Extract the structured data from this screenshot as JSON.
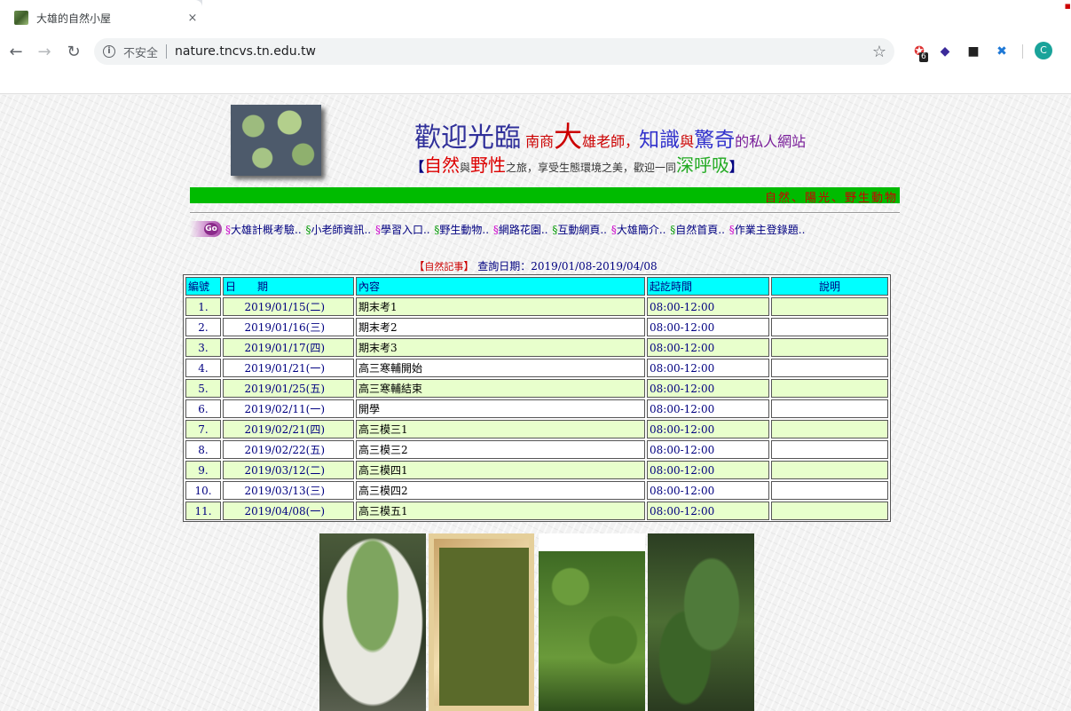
{
  "browser": {
    "tab_title": "大雄的自然小屋",
    "tab_close": "×",
    "insecure_label": "不安全",
    "url": "nature.tncvs.tn.edu.tw",
    "extension_badge": "6",
    "profile_initial": "C"
  },
  "header": {
    "welcome": {
      "part1": "歡迎光臨",
      "part2": "南商",
      "part3": "大",
      "part4": "雄老師，",
      "part5": "知識",
      "part6": "與",
      "part7": "驚奇",
      "part8": "的私人網站"
    },
    "slogan": {
      "open": "【",
      "a": "自然",
      "b": "與",
      "c": "野性",
      "d": "之旅，享受生態環境之美，歡迎一同",
      "e": "深呼吸",
      "close": "】"
    },
    "marquee": "自然、陽光、野生動物"
  },
  "nav": {
    "go_label": "Go",
    "links": [
      {
        "sec": "§",
        "label": "大雄計概考驗.."
      },
      {
        "sec": "§",
        "label": "小老師資訊.."
      },
      {
        "sec": "§",
        "label": "學習入口.."
      },
      {
        "sec": "§",
        "label": "野生動物.."
      },
      {
        "sec": "§",
        "label": "網路花園.."
      },
      {
        "sec": "§",
        "label": "互動網頁.."
      },
      {
        "sec": "§",
        "label": "大雄簡介.."
      },
      {
        "sec": "§",
        "label": "自然首頁.."
      },
      {
        "sec": "§",
        "label": "作業主登錄題.."
      }
    ]
  },
  "query": {
    "open": "【",
    "tag": "自然記事",
    "close": "】",
    "label": " 查詢日期：",
    "range": "2019/01/08-2019/04/08"
  },
  "table": {
    "headers": {
      "no": "編號",
      "date": "日　　期",
      "content": "內容",
      "time": "起訖時間",
      "note": "說明"
    },
    "rows": [
      {
        "no": "1.",
        "date": "2019/01/15(二)",
        "content": "期末考1",
        "time": "08:00-12:00",
        "note": ""
      },
      {
        "no": "2.",
        "date": "2019/01/16(三)",
        "content": "期末考2",
        "time": "08:00-12:00",
        "note": ""
      },
      {
        "no": "3.",
        "date": "2019/01/17(四)",
        "content": "期末考3",
        "time": "08:00-12:00",
        "note": ""
      },
      {
        "no": "4.",
        "date": "2019/01/21(一)",
        "content": "高三寒輔開始",
        "time": "08:00-12:00",
        "note": ""
      },
      {
        "no": "5.",
        "date": "2019/01/25(五)",
        "content": "高三寒輔結束",
        "time": "08:00-12:00",
        "note": ""
      },
      {
        "no": "6.",
        "date": "2019/02/11(一)",
        "content": "開學",
        "time": "08:00-12:00",
        "note": ""
      },
      {
        "no": "7.",
        "date": "2019/02/21(四)",
        "content": "高三模三1",
        "time": "08:00-12:00",
        "note": ""
      },
      {
        "no": "8.",
        "date": "2019/02/22(五)",
        "content": "高三模三2",
        "time": "08:00-12:00",
        "note": ""
      },
      {
        "no": "9.",
        "date": "2019/03/12(二)",
        "content": "高三模四1",
        "time": "08:00-12:00",
        "note": ""
      },
      {
        "no": "10.",
        "date": "2019/03/13(三)",
        "content": "高三模四2",
        "time": "08:00-12:00",
        "note": ""
      },
      {
        "no": "11.",
        "date": "2019/04/08(一)",
        "content": "高三模五1",
        "time": "08:00-12:00",
        "note": ""
      }
    ]
  },
  "icons": {
    "back": "back-arrow-icon",
    "forward": "forward-arrow-icon",
    "reload": "reload-icon",
    "info": "info-icon",
    "star": "star-icon"
  }
}
